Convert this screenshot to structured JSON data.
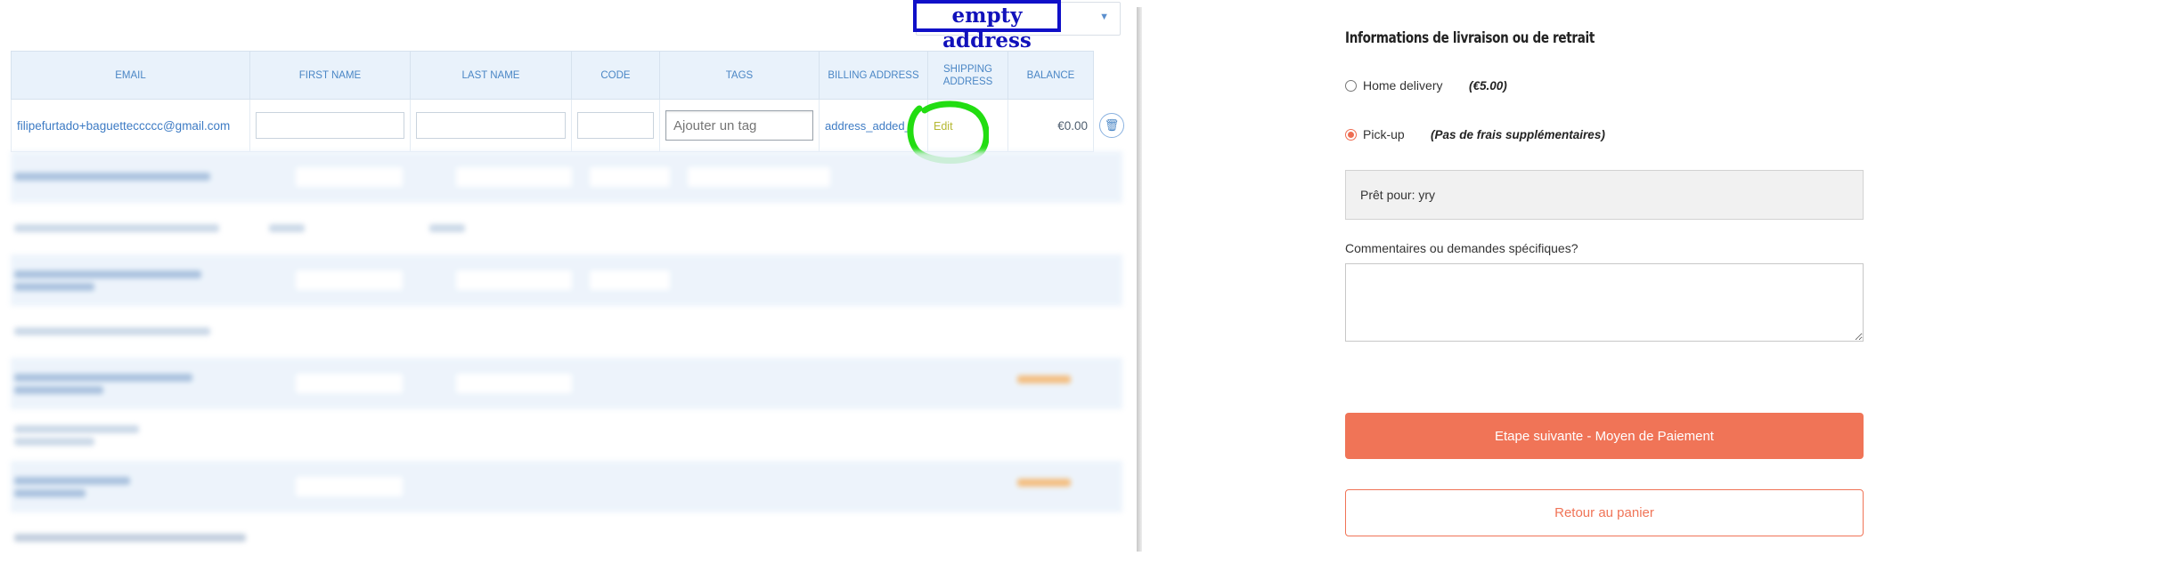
{
  "admin": {
    "annotation_label": "empty address",
    "dropdown_caret": "▼",
    "columns": [
      "EMAIL",
      "FIRST NAME",
      "LAST NAME",
      "CODE",
      "TAGS",
      "BILLING ADDRESS",
      "SHIPPING ADDRESS",
      "BALANCE"
    ],
    "row": {
      "email": "filipefurtado+baguetteccccc@gmail.com",
      "first_name": "",
      "last_name": "",
      "code": "",
      "tags_placeholder": "Ajouter un tag",
      "billing_address": "address_added_",
      "shipping_address": "Edit",
      "balance": "€0.00"
    },
    "icons": {
      "delete": "trash-icon"
    },
    "colors": {
      "header_bg": "#e9f2fb",
      "link": "#4a86c5",
      "highlight_circle": "#22dd11",
      "annotation": "#1111bb"
    }
  },
  "checkout": {
    "section_title": "Informations de livraison ou de retrait",
    "options": [
      {
        "label": "Home delivery",
        "note": "(€5.00)",
        "selected": false
      },
      {
        "label": "Pick-up",
        "note": "(Pas de frais supplémentaires)",
        "selected": true
      }
    ],
    "ready_for": "Prêt pour: yry",
    "comments_label": "Commentaires ou demandes spécifiques?",
    "comments_value": "",
    "next_button": "Etape suivante - Moyen de Paiement",
    "back_button": "Retour au panier",
    "colors": {
      "accent": "#f07457"
    }
  }
}
